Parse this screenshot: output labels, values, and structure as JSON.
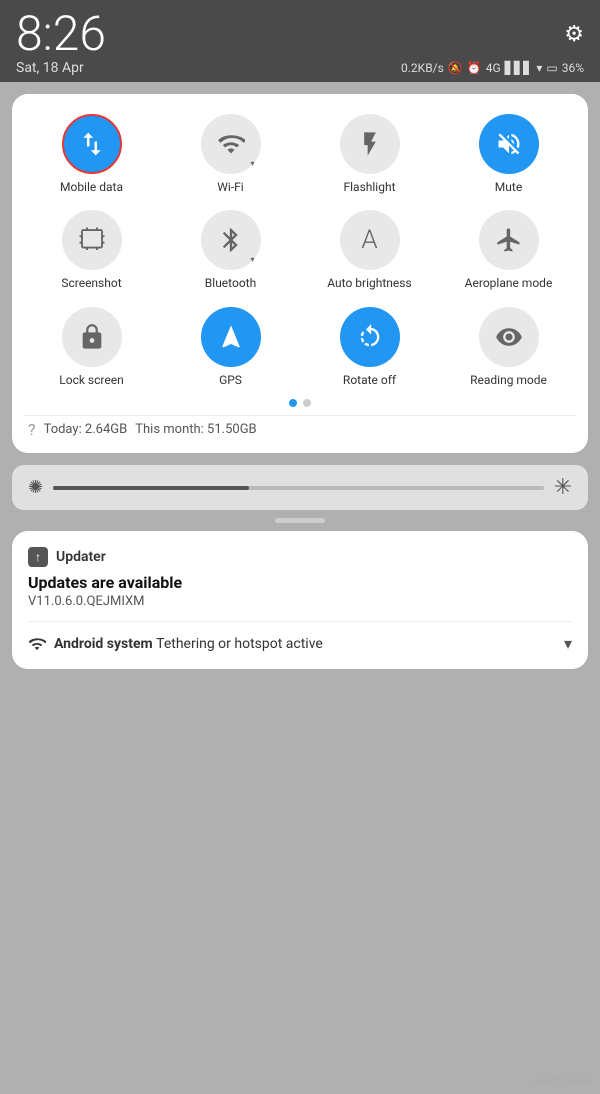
{
  "statusBar": {
    "time": "8:26",
    "date": "Sat, 18 Apr",
    "speed": "0.2KB/s",
    "battery": "36%"
  },
  "tiles": [
    {
      "id": "mobile-data",
      "label": "Mobile data",
      "icon": "mobile-data",
      "active": true,
      "highlighted": true
    },
    {
      "id": "wifi",
      "label": "Wi-Fi",
      "icon": "wifi",
      "active": false,
      "highlighted": false
    },
    {
      "id": "flashlight",
      "label": "Flashlight",
      "icon": "flashlight",
      "active": false,
      "highlighted": false
    },
    {
      "id": "mute",
      "label": "Mute",
      "icon": "mute",
      "active": true,
      "highlighted": false
    },
    {
      "id": "screenshot",
      "label": "Screenshot",
      "icon": "screenshot",
      "active": false,
      "highlighted": false
    },
    {
      "id": "bluetooth",
      "label": "Bluetooth",
      "icon": "bluetooth",
      "active": false,
      "highlighted": false
    },
    {
      "id": "auto-brightness",
      "label": "Auto brightness",
      "icon": "auto-brightness",
      "active": false,
      "highlighted": false
    },
    {
      "id": "aeroplane",
      "label": "Aeroplane mode",
      "icon": "aeroplane",
      "active": false,
      "highlighted": false
    },
    {
      "id": "lock-screen",
      "label": "Lock screen",
      "icon": "lock",
      "active": false,
      "highlighted": false
    },
    {
      "id": "gps",
      "label": "GPS",
      "icon": "gps",
      "active": true,
      "highlighted": false
    },
    {
      "id": "rotate",
      "label": "Rotate off",
      "icon": "rotate",
      "active": true,
      "highlighted": false
    },
    {
      "id": "reading-mode",
      "label": "Reading mode",
      "icon": "reading",
      "active": false,
      "highlighted": false
    }
  ],
  "dataUsage": {
    "today": "Today: 2.64GB",
    "month": "This month: 51.50GB"
  },
  "notification": {
    "appIcon": "↑",
    "appName": "Updater",
    "title": "Updates are available",
    "body": "V11.0.6.0.QEJMIXM",
    "secondIcon": "wifi",
    "secondApp": "Android system",
    "secondText": "Tethering or hotspot active"
  },
  "watermark": "wsxdn.com"
}
